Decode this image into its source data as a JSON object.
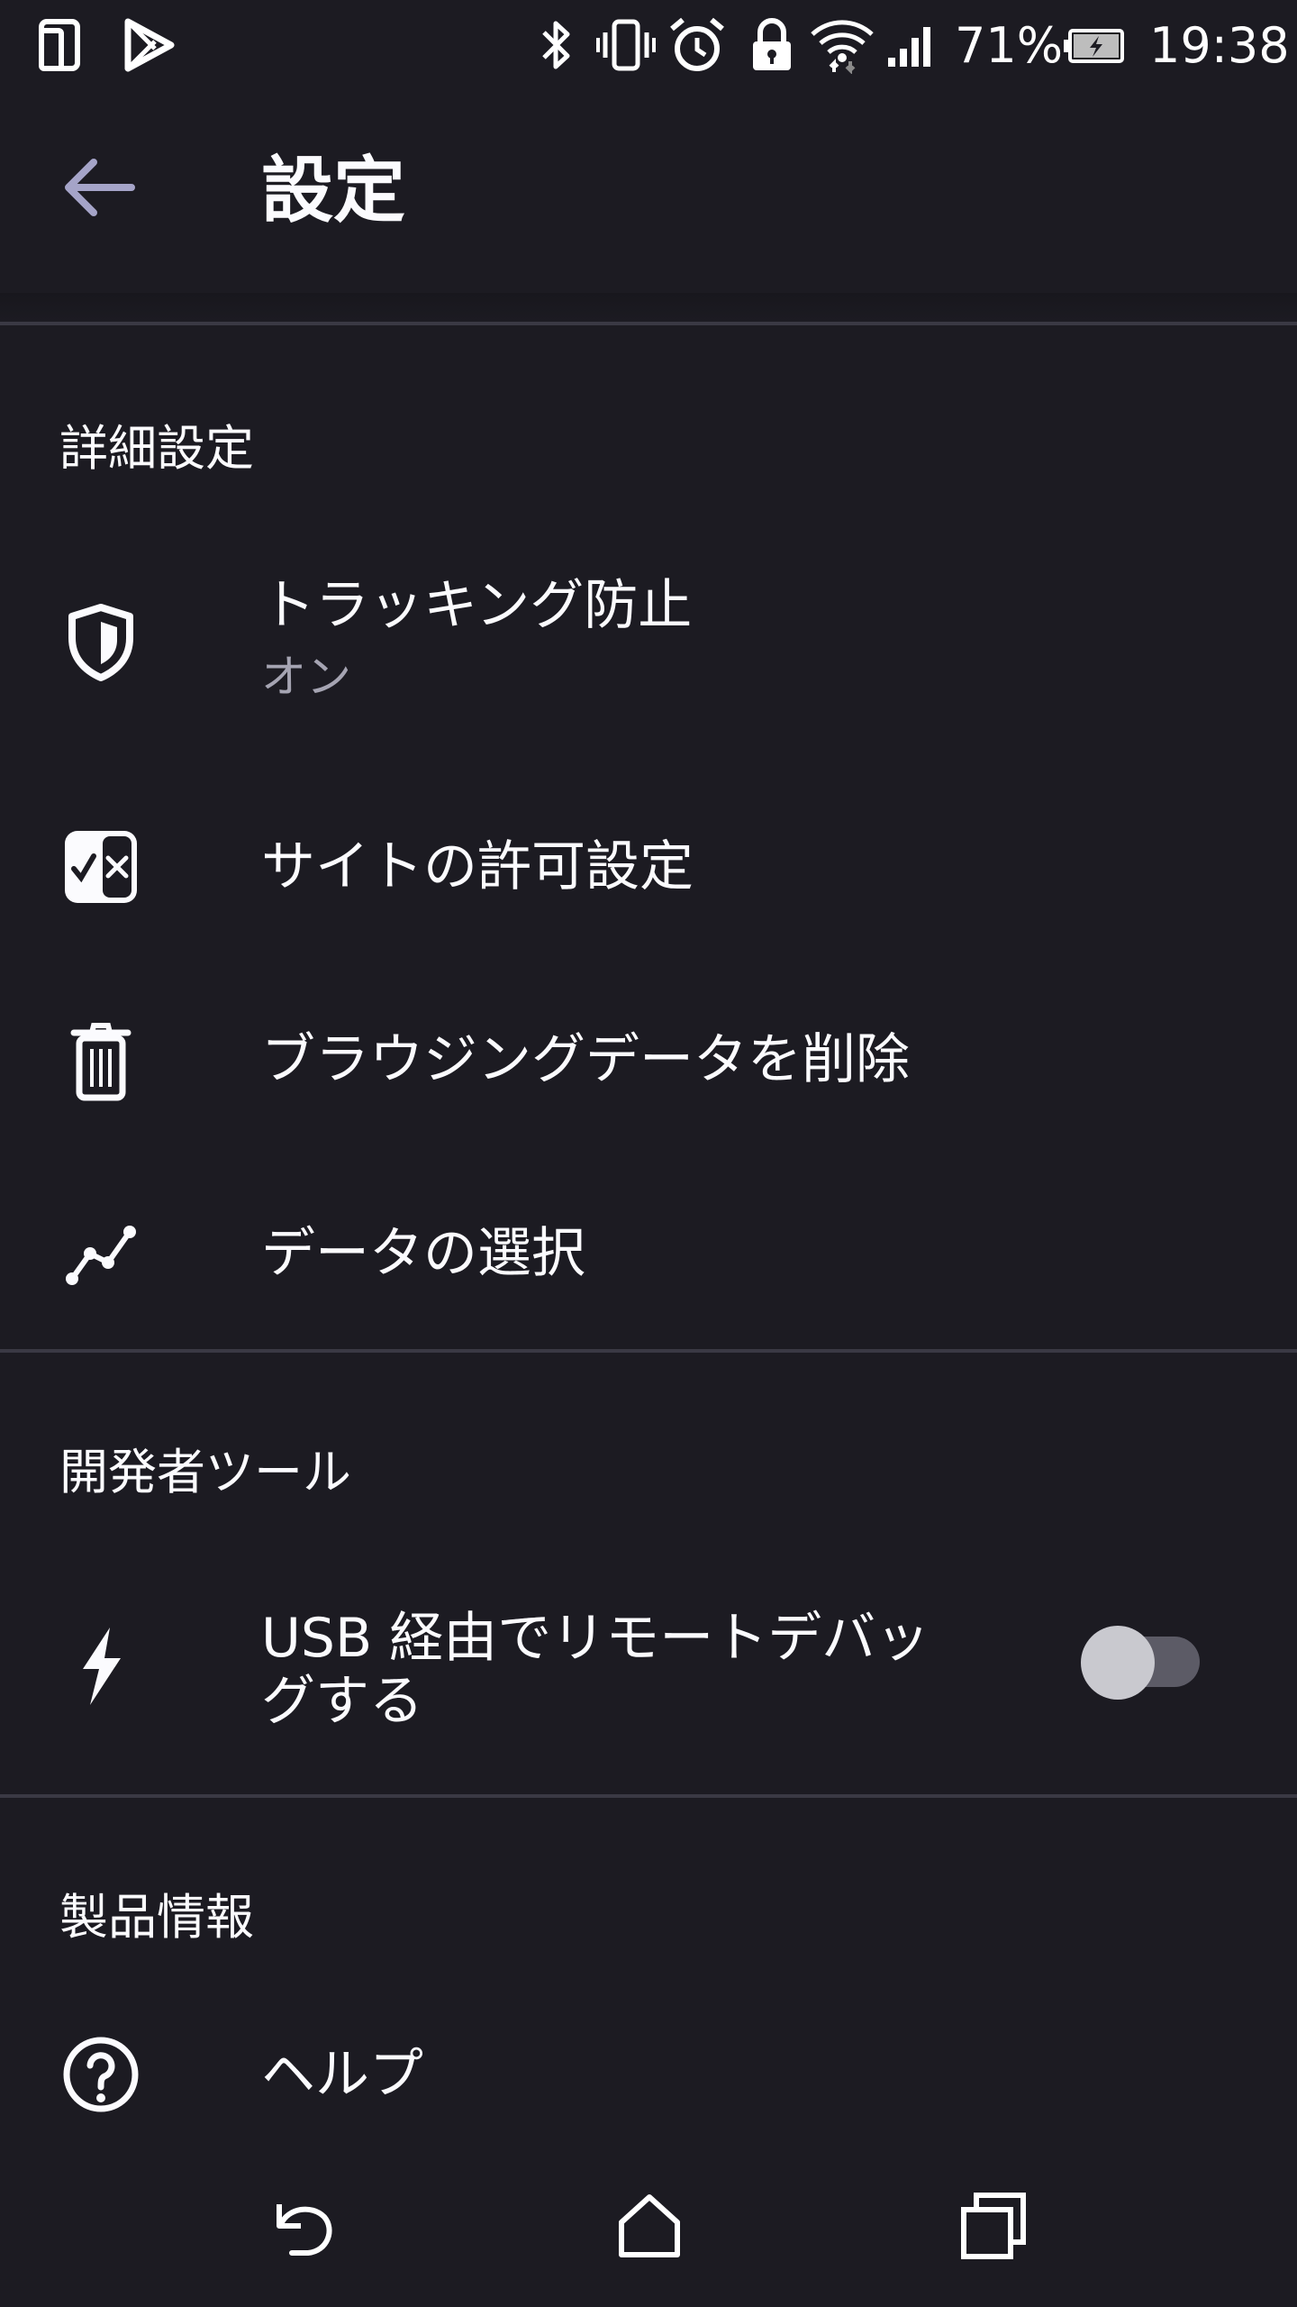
{
  "status_bar": {
    "battery_percent": "71%",
    "time": "19:38",
    "icons": [
      "phone-icon",
      "play-store-icon",
      "bluetooth-icon",
      "vibrate-icon",
      "alarm-icon",
      "lock-icon",
      "wifi-icon",
      "signal-icon",
      "battery-charging-icon"
    ]
  },
  "toolbar": {
    "title": "設定",
    "back_icon": "arrow-back-icon"
  },
  "sections": {
    "advanced": {
      "title": "詳細設定",
      "items": [
        {
          "title": "トラッキング防止",
          "summary": "オン",
          "icon": "shield-icon"
        },
        {
          "title": "サイトの許可設定",
          "icon": "site-permissions-icon"
        },
        {
          "title": "ブラウジングデータを削除",
          "icon": "trash-icon"
        },
        {
          "title": "データの選択",
          "icon": "data-chart-icon"
        }
      ]
    },
    "developer": {
      "title": "開発者ツール",
      "items": [
        {
          "title_line1": "USB 経由でリモートデバッ",
          "title_line2": "グする",
          "icon": "lightning-icon",
          "toggle_on": false
        }
      ]
    },
    "about": {
      "title": "製品情報",
      "items": [
        {
          "title": "ヘルプ",
          "icon": "help-icon"
        }
      ]
    }
  },
  "nav_bar": {
    "buttons": [
      "back-nav-icon",
      "home-icon",
      "recents-icon"
    ]
  },
  "colors": {
    "background": "#1c1b22",
    "text": "#fbfbfe",
    "secondary_text": "#a5a4b2",
    "divider": "#3a3944",
    "accent_back_arrow": "#a5a4c8"
  }
}
